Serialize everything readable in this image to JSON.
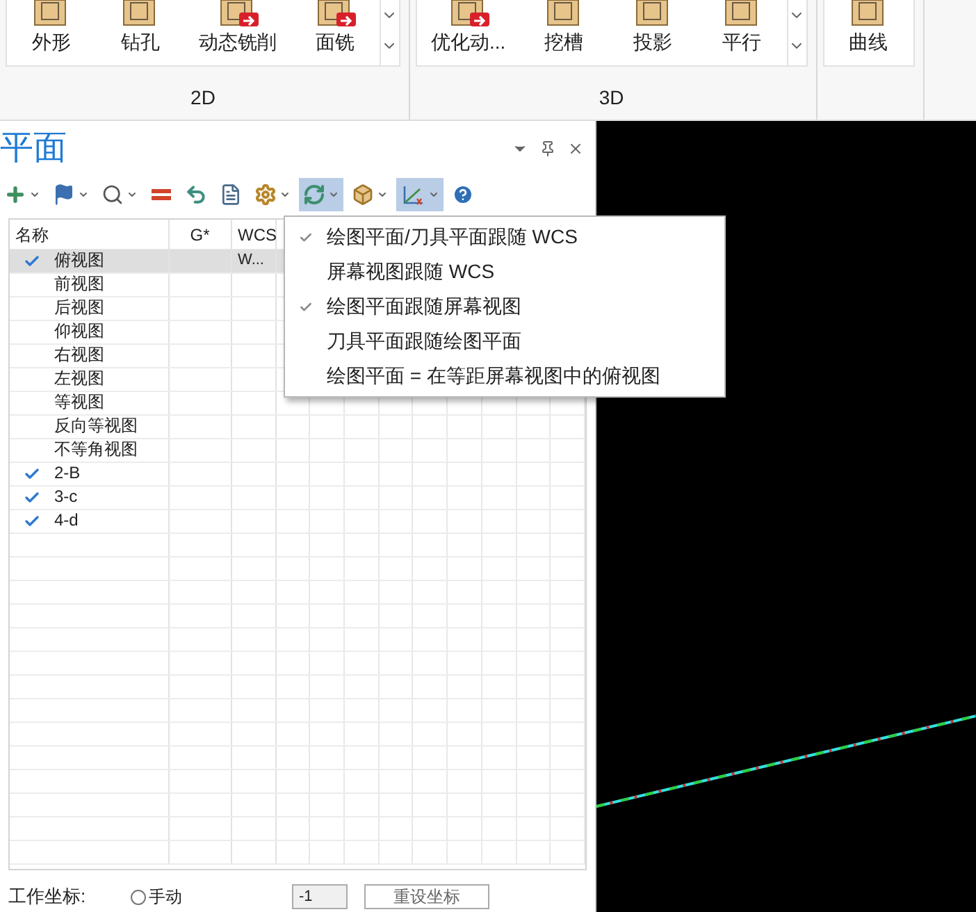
{
  "ribbon": {
    "groups": [
      {
        "label": "2D",
        "items": [
          {
            "label": "外形",
            "badge": false
          },
          {
            "label": "钻孔",
            "badge": false
          },
          {
            "label": "动态铣削",
            "badge": true
          },
          {
            "label": "面铣",
            "badge": true
          }
        ]
      },
      {
        "label": "3D",
        "items": [
          {
            "label": "优化动...",
            "badge": true
          },
          {
            "label": "挖槽",
            "badge": false
          },
          {
            "label": "投影",
            "badge": false
          },
          {
            "label": "平行",
            "badge": false
          }
        ]
      },
      {
        "items": [
          {
            "label": "曲线",
            "badge": false
          }
        ]
      }
    ]
  },
  "panel": {
    "title": "平面",
    "toolbar": [
      {
        "kind": "add",
        "dropdown": true,
        "selected": false
      },
      {
        "kind": "flag",
        "dropdown": true,
        "selected": false
      },
      {
        "kind": "search",
        "dropdown": true,
        "selected": false
      },
      {
        "kind": "equal",
        "dropdown": false,
        "selected": false
      },
      {
        "kind": "undo",
        "dropdown": false,
        "selected": false
      },
      {
        "kind": "list",
        "dropdown": false,
        "selected": false
      },
      {
        "kind": "gear",
        "dropdown": true,
        "selected": false
      },
      {
        "kind": "cycle",
        "dropdown": true,
        "selected": true
      },
      {
        "kind": "cube",
        "dropdown": true,
        "selected": false
      },
      {
        "kind": "axes",
        "dropdown": true,
        "selected": true
      },
      {
        "kind": "help",
        "dropdown": false,
        "selected": false
      }
    ],
    "table": {
      "columns": [
        "名称",
        "G*",
        "WCS"
      ],
      "rows": [
        {
          "name": "俯视图",
          "checked": true,
          "selected": true,
          "wcs": "W..."
        },
        {
          "name": "前视图",
          "checked": false,
          "selected": false
        },
        {
          "name": "后视图",
          "checked": false,
          "selected": false
        },
        {
          "name": "仰视图",
          "checked": false,
          "selected": false
        },
        {
          "name": "右视图",
          "checked": false,
          "selected": false
        },
        {
          "name": "左视图",
          "checked": false,
          "selected": false
        },
        {
          "name": "等视图",
          "checked": false,
          "selected": false
        },
        {
          "name": "反向等视图",
          "checked": false,
          "selected": false
        },
        {
          "name": "不等角视图",
          "checked": false,
          "selected": false
        },
        {
          "name": "2-B",
          "checked": true,
          "selected": false
        },
        {
          "name": "3-c",
          "checked": true,
          "selected": false
        },
        {
          "name": "4-d",
          "checked": true,
          "selected": false
        }
      ]
    },
    "menu": [
      {
        "label": "绘图平面/刀具平面跟随 WCS",
        "checked": true
      },
      {
        "label": "屏幕视图跟随 WCS",
        "checked": false
      },
      {
        "label": "绘图平面跟随屏幕视图",
        "checked": true
      },
      {
        "label": "刀具平面跟随绘图平面",
        "checked": false
      },
      {
        "label": "绘图平面 = 在等距屏幕视图中的俯视图",
        "checked": false
      }
    ],
    "footer": {
      "label": "工作坐标:",
      "radio": {
        "label": "手动",
        "selected": false
      },
      "field": "-1",
      "button": "重设坐标"
    }
  }
}
